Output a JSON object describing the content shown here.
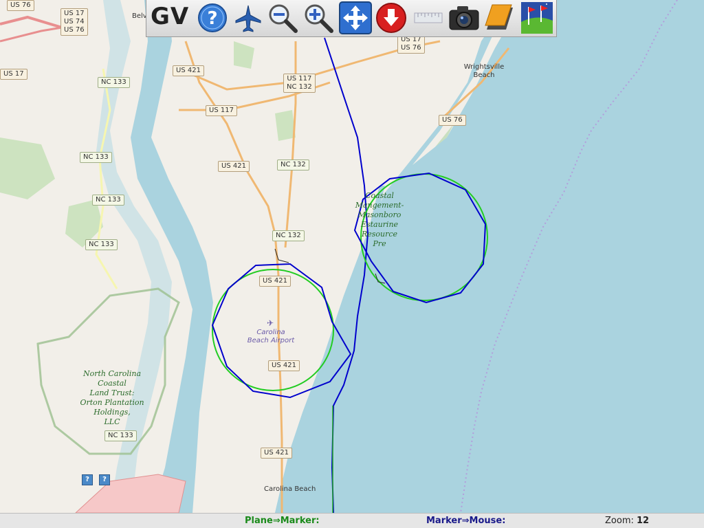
{
  "toolbar": {
    "logo": "GV",
    "buttons": [
      {
        "name": "help-button",
        "icon": "help-icon"
      },
      {
        "name": "plane-button",
        "icon": "airplane-icon"
      },
      {
        "name": "zoom-out-button",
        "icon": "zoom-out-icon"
      },
      {
        "name": "zoom-in-button",
        "icon": "zoom-in-icon"
      },
      {
        "name": "pan-button",
        "icon": "move-arrows-icon"
      },
      {
        "name": "download-button",
        "icon": "download-icon"
      },
      {
        "name": "ruler-button",
        "icon": "ruler-icon"
      },
      {
        "name": "camera-button",
        "icon": "camera-icon"
      },
      {
        "name": "layer-button",
        "icon": "layer-icon"
      },
      {
        "name": "markers-button",
        "icon": "flags-icon"
      }
    ]
  },
  "map": {
    "road_shields": {
      "us76_tl": "US 76",
      "us17_74_76": [
        "US 17",
        "US 74",
        "US 76"
      ],
      "us17_left": "US 17",
      "nc133_a": "NC 133",
      "nc133_b": "NC 133",
      "nc133_c": "NC 133",
      "nc133_d": "NC 133",
      "nc133_e": "NC 133",
      "us421_a": "US 421",
      "us117": "US 117",
      "us117_nc132": [
        "US 117",
        "NC 132"
      ],
      "us421_b": "US 421",
      "nc132_a": "NC 132",
      "nc132_b": "NC 132",
      "us421_c": "US 421",
      "us421_d": "US 421",
      "us421_e": "US 421",
      "us17_76_top": [
        "US 17",
        "US 76"
      ],
      "us76_right": "US 76"
    },
    "places": {
      "belville": "Belv",
      "wrightsville": "Wrightsville Beach",
      "carolina_beach": "Carolina Beach"
    },
    "parks": {
      "masonboro": [
        "Coastal",
        "Mangement-",
        "Masonboro",
        "Estaurine",
        "Resource",
        "Pre"
      ],
      "orton": [
        "North Carolina",
        "Coastal",
        "Land Trust:",
        "Orton Plantation",
        "Holdings,",
        "LLC"
      ]
    },
    "airport": [
      "Carolina",
      "Beach Airport"
    ],
    "colors": {
      "water": "#aad3df",
      "land": "#f2efe9",
      "track": "#0000cc",
      "circle_outer": "#22cc22"
    }
  },
  "status": {
    "plane_marker_label": "Plane⇒Marker:",
    "marker_mouse_label": "Marker⇒Mouse:",
    "zoom_label": "Zoom:",
    "zoom_value": "12"
  }
}
